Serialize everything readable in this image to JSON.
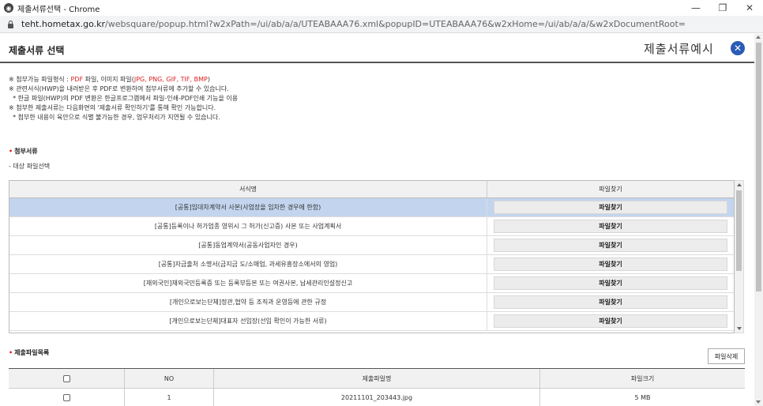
{
  "window": {
    "title": "제출서류선택 - Chrome",
    "minimize": "—",
    "restore": "❐",
    "close": "✕",
    "url_host": "teht.hometax.go.kr",
    "url_path": "/websquare/popup.html?w2xPath=/ui/ab/a/a/UTEABAAA76.xml&popupID=UTEABAAA76&w2xHome=/ui/ab/a/a/&w2xDocumentRoot="
  },
  "header": {
    "title": "제출서류 선택",
    "example_label": "제출서류예시",
    "close_symbol": "✕"
  },
  "notes": {
    "line1_pre": "※ 첨부가능 파일형식 : ",
    "line1_pdf": "PDF",
    "line1_mid": " 파일, 이미지 파일(",
    "line1_img": "JPG, PNG, GIF, TIF, BMP",
    "line1_post": ")",
    "line2": "※ 관련서식(HWP)을 내려받은 후 PDF로 변환하여 첨부서류에 추가할 수 있습니다.",
    "line3": "  * 한글 파일(HWP)의 PDF 변환은 한글프로그램에서 파일-인쇄-PDF인쇄 기능을 이용",
    "line4": "※ 첨부한 제출서류는 다음화면의 '제출서류 확인하기'를 통해 확인 가능합니다.",
    "line5": "  * 첨부한 내용이 육안으로 식별 불가능한 경우, 업무처리가 지연될 수 있습니다."
  },
  "attach_section": {
    "bullet": "•",
    "label": "첨부서류",
    "sub_label": "- 대상 파일선택"
  },
  "doc_grid": {
    "col_form": "서식명",
    "col_find": "파일찾기",
    "find_label": "파일찾기",
    "rows": [
      {
        "name": "[공통]임대차계약서 사본(사업장을 임차한 경우에 한함)"
      },
      {
        "name": "[공통]등록이나 허가업종 영위시 그 허가(신고증) 사본 또는 사업계획서"
      },
      {
        "name": "[공통]동업계약서(공동사업자인 경우)"
      },
      {
        "name": "[공통]자금출처 소명서(금지금 도/소매업, 과세유흥장소에서의 영업)"
      },
      {
        "name": "[재외국인]재외국민등록증 또는 등록부등본 또는 여권사본, 납세관리인설정신고"
      },
      {
        "name": "[개인으로보는단체]정관,협약 등 조직과 운영등에 관한 규정"
      },
      {
        "name": "[개인으로보는단체]대표자 선임장(선임 확인이 가능한 서류)"
      }
    ]
  },
  "submit_section": {
    "bullet": "•",
    "label": "제출파일목록",
    "delete_button": "파일삭제"
  },
  "file_grid": {
    "col_no": "NO",
    "col_name": "제출파일명",
    "col_size": "파일크기",
    "rows": [
      {
        "no": "1",
        "name": "20211101_203443.jpg",
        "size": "5 MB"
      }
    ]
  }
}
